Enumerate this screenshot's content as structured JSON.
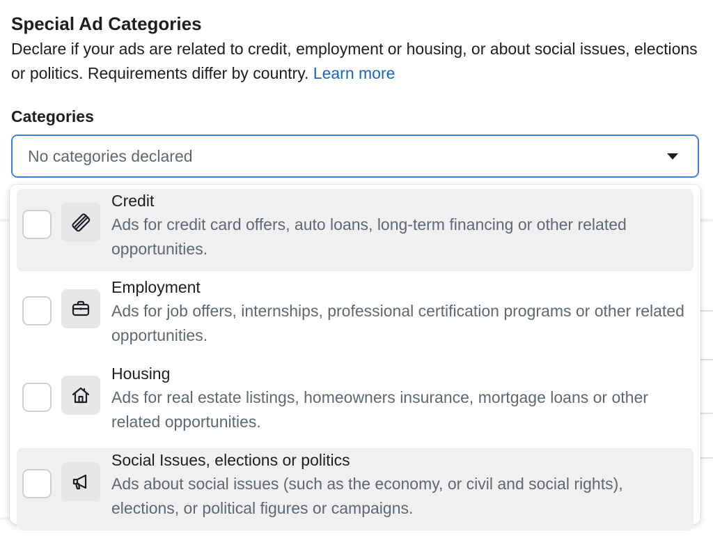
{
  "section": {
    "title": "Special Ad Categories",
    "description": "Declare if your ads are related to credit, employment or housing, or about social issues, elections or politics. Requirements differ by country.",
    "learn_more": "Learn more"
  },
  "categories_field": {
    "label": "Categories",
    "value": "No categories declared"
  },
  "options": [
    {
      "title": "Credit",
      "description": "Ads for credit card offers, auto loans, long-term financing or other related opportunities.",
      "icon": "credit-card-icon",
      "checked": false
    },
    {
      "title": "Employment",
      "description": "Ads for job offers, internships, professional certification programs or other related opportunities.",
      "icon": "briefcase-icon",
      "checked": false
    },
    {
      "title": "Housing",
      "description": "Ads for real estate listings, homeowners insurance, mortgage loans or other related opportunities.",
      "icon": "house-icon",
      "checked": false
    },
    {
      "title": "Social Issues, elections or politics",
      "description": "Ads about social issues (such as the economy, or civil and social rights), elections, or political figures or campaigns.",
      "icon": "megaphone-icon",
      "checked": false
    }
  ],
  "colors": {
    "accent": "#3b7ee8",
    "link": "#1767c2",
    "hover_row": "#f0f0f0",
    "muted_text": "#606770"
  }
}
